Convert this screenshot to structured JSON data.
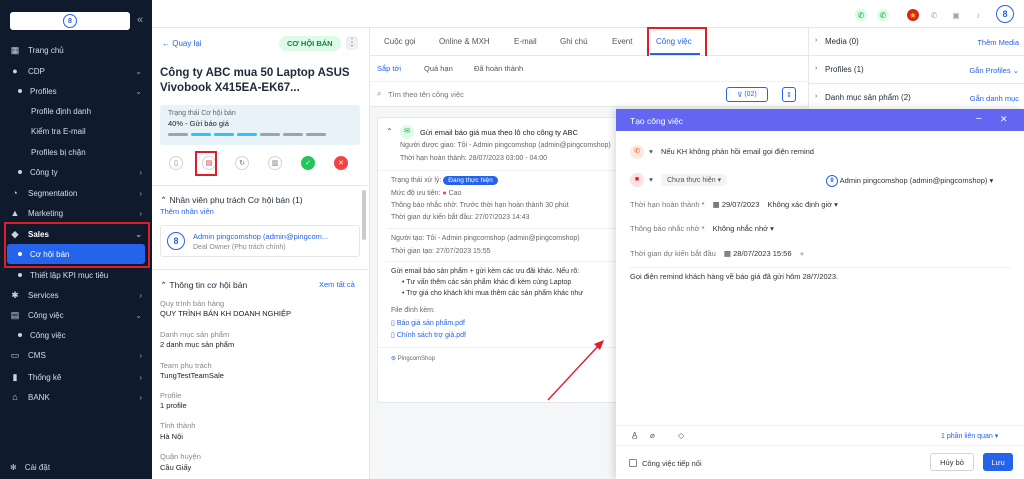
{
  "sidebar": {
    "items": [
      {
        "label": "Trang chủ",
        "icon": "grid-icon"
      },
      {
        "label": "CDP",
        "icon": "user-icon"
      },
      {
        "label": "Profiles"
      },
      {
        "label": "Profile định danh"
      },
      {
        "label": "Kiểm tra E-mail"
      },
      {
        "label": "Profiles bị chặn"
      },
      {
        "label": "Công ty"
      },
      {
        "label": "Segmentation",
        "icon": "pie-icon"
      },
      {
        "label": "Marketing",
        "icon": "megaphone-icon"
      },
      {
        "label": "Sales",
        "icon": "box-icon"
      },
      {
        "label": "Cơ hội bán"
      },
      {
        "label": "Thiết lập KPI mục tiêu"
      },
      {
        "label": "Services",
        "icon": "services-icon"
      },
      {
        "label": "Công việc",
        "icon": "task-icon"
      },
      {
        "label": "Công việc"
      },
      {
        "label": "CMS",
        "icon": "monitor-icon"
      },
      {
        "label": "Thống kê",
        "icon": "bars-icon"
      },
      {
        "label": "BANK",
        "icon": "bank-icon"
      }
    ],
    "settings_label": "Cài đặt"
  },
  "detail": {
    "back_label": "Quay lại",
    "badge": "CƠ HỘI BÁN",
    "title": "Công ty ABC mua 50 Laptop ASUS Vivobook X415EA-EK67...",
    "status_label": "Trạng thái Cơ hội bán",
    "status_value": "40% - Gửi báo giá",
    "owner_section": "Nhân viên phụ trách Cơ hội bán (1)",
    "add_owner": "Thêm nhân viên",
    "owner_name": "Admin pingcomshop (admin@pingcom...",
    "owner_role": "Deal Owner (Phụ trách chính)",
    "info_section": "Thông tin cơ hội bán",
    "collapse_all": "Xem tất cả",
    "fields": [
      {
        "label": "Quy trình bán hàng",
        "value": "QUY TRÌNH BÁN KH DOANH NGHIỆP"
      },
      {
        "label": "Danh mục sản phẩm",
        "value": "2 danh mục sản phẩm"
      },
      {
        "label": "Team phụ trách",
        "value": "TungTestTeamSale"
      },
      {
        "label": "Profile",
        "value": "1 profile"
      },
      {
        "label": "Tỉnh thành",
        "value": "Hà Nội"
      },
      {
        "label": "Quận huyện",
        "value": "Cầu Giấy"
      }
    ]
  },
  "tabs": [
    "Cuộc gọi",
    "Online & MXH",
    "E-mail",
    "Ghi chú",
    "Event",
    "Công việc"
  ],
  "subtabs": [
    "Sắp tới",
    "Quá hạn",
    "Đã hoàn thành"
  ],
  "search": {
    "placeholder": "Tìm theo tên công việc",
    "filter_count": "(02)"
  },
  "task": {
    "title": "Gửi email báo giá mua theo lô cho công ty ABC",
    "assignee": "Người được giao: Tôi - Admin pingcomshop (admin@pingcomshop)",
    "deadline": "Thời hạn hoàn thành: 28/07/2023 03:00 - 04:00",
    "status_label": "Trạng thái xử lý:",
    "status_value": "Đang thực hiện",
    "priority_label": "Mức độ ưu tiên:",
    "priority_value": "Cao",
    "reminder": "Thông báo nhắc nhở: Trước thời hạn hoàn thành 30 phút",
    "start": "Thời gian dự kiến bắt đầu: 27/07/2023 14:43",
    "creator": "Người tạo: Tôi - Admin pingcomshop (admin@pingcomshop)",
    "created": "Thời gian tạo: 27/07/2023 15:55",
    "desc": "Gửi email báo sản phẩm + gửi kèm các ưu đãi khác. Nếu rõ:",
    "bullets": [
      "Tư vấn thêm các sản phẩm khác đi kèm cùng Laptop",
      "Trợ giá cho khách khi mua thêm các sản phẩm khác như"
    ],
    "attach_label": "File đính kèm:",
    "files": [
      "Báo giá sản phẩm.pdf",
      "Chính sách trợ giá.pdf"
    ],
    "brand": "PingcomShop"
  },
  "right": {
    "rows": [
      {
        "title": "Media (0)",
        "action": "Thêm Media"
      },
      {
        "title": "Profiles (1)",
        "action": "Gắn Profiles"
      },
      {
        "title": "Danh mục sản phẩm (2)",
        "action": "Gắn danh mục"
      }
    ]
  },
  "modal": {
    "title": "Tạo công việc",
    "task_name": "Nếu KH không phản hồi email gọi điện remind",
    "status": "Chưa thực hiện",
    "assignee": "Admin pingcomshop (admin@pingcomshop)",
    "deadline_label": "Thời hạn hoàn thành",
    "deadline_date": "29/07/2023",
    "deadline_time": "Không xác định giờ",
    "reminder_label": "Thông báo nhắc nhở",
    "reminder_value": "Không nhắc nhở",
    "start_label": "Thời gian dự kiến bắt đầu",
    "start_value": "28/07/2023 15:56",
    "content": "Gọi điện remind khách hàng về báo giá đã gửi hôm 28/7/2023.",
    "related": "1 phần liên quan",
    "follow_up": "Công việc tiếp nối",
    "cancel": "Hủy bỏ",
    "save": "Lưu"
  },
  "colors": {
    "accent": "#2563eb",
    "modal_header": "#6366f1",
    "sidebar": "#0f1b2d",
    "annotation": "#e11d2a"
  }
}
